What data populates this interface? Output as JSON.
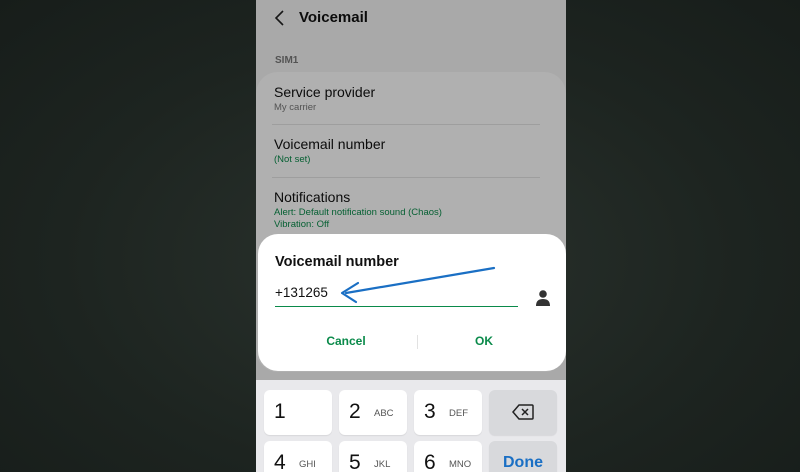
{
  "header": {
    "title": "Voicemail",
    "back_icon": "back-arrow-icon"
  },
  "section_label": "SIM1",
  "settings": [
    {
      "title": "Service provider",
      "subtitle": "My carrier",
      "subtitle_color": "#777777"
    },
    {
      "title": "Voicemail number",
      "subtitle": "(Not set)",
      "subtitle_color": "#0a8a4a"
    },
    {
      "title": "Notifications",
      "subtitle": "Alert: Default notification sound (Chaos)",
      "subtitle2": "Vibration: Off",
      "subtitle_color": "#0a8a4a"
    }
  ],
  "dialog": {
    "title": "Voicemail number",
    "input_value": "+131265",
    "contact_icon": "contact-person-icon",
    "cancel_label": "Cancel",
    "ok_label": "OK"
  },
  "keyboard": {
    "keys": [
      {
        "num": "1",
        "letters": ""
      },
      {
        "num": "2",
        "letters": "ABC"
      },
      {
        "num": "3",
        "letters": "DEF"
      },
      {
        "num": "4",
        "letters": "GHI"
      },
      {
        "num": "5",
        "letters": "JKL"
      },
      {
        "num": "6",
        "letters": "MNO"
      }
    ],
    "backspace_icon": "backspace-icon",
    "done_label": "Done"
  },
  "colors": {
    "accent": "#0a8a4a",
    "annotation_arrow": "#1a6fc4",
    "done_text": "#1a6fc4"
  }
}
